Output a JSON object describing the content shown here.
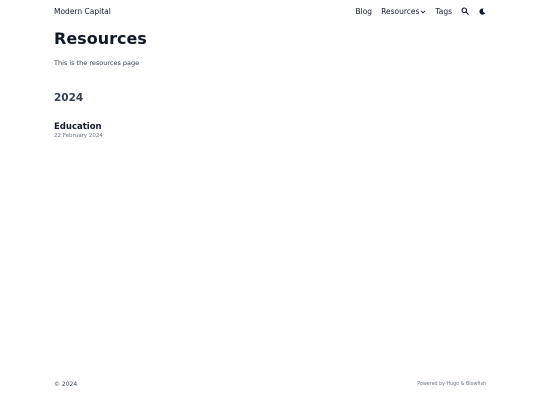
{
  "header": {
    "site_title": "Modern Capital",
    "nav": {
      "blog": "Blog",
      "resources": "Resources",
      "tags": "Tags"
    },
    "icons": {
      "search": "search-icon",
      "theme": "moon-icon",
      "dropdown": "chevron-down-icon"
    }
  },
  "main": {
    "title": "Resources",
    "description": "This is the resources page",
    "groups": [
      {
        "year": "2024",
        "articles": [
          {
            "title": "Education",
            "date": "22 February 2024"
          }
        ]
      }
    ]
  },
  "footer": {
    "copyright": "© 2024",
    "powered_by": "Powered by Hugo & Blowfish"
  },
  "colors": {
    "text_primary": "#111827",
    "text_secondary": "#374151",
    "text_muted": "#6b7280",
    "background": "#ffffff"
  }
}
